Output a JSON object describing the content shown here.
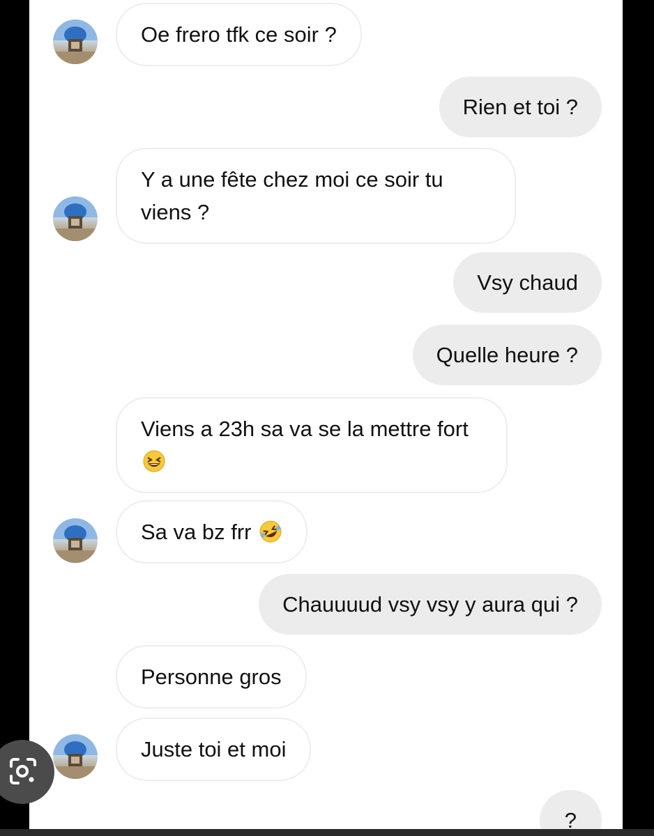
{
  "messages": [
    {
      "text": "Oe frero tfk ce soir ?"
    },
    {
      "text": "Rien et toi ?"
    },
    {
      "text": "Y a une fête chez moi ce soir tu viens ?"
    },
    {
      "text": "Vsy chaud"
    },
    {
      "text": "Quelle heure ?"
    },
    {
      "text": "Viens a 23h sa va se la mettre fort"
    },
    {
      "text": "Sa va bz frr"
    },
    {
      "text": "Chauuuud vsy vsy y aura qui ?"
    },
    {
      "text": "Personne gros"
    },
    {
      "text": "Juste toi et moi"
    },
    {
      "text": "?"
    }
  ],
  "icons": {
    "avatar": "contact-avatar-photo",
    "emoji_1": "grinning-squinting-face-emoji",
    "emoji_2": "rolling-on-the-floor-laughing-emoji",
    "overlay_button": "lens-search-icon"
  },
  "colors": {
    "received_bubble": "#ffffff",
    "sent_bubble": "#ececec",
    "text": "#111111",
    "overlay_button": "#4b4b4b"
  }
}
